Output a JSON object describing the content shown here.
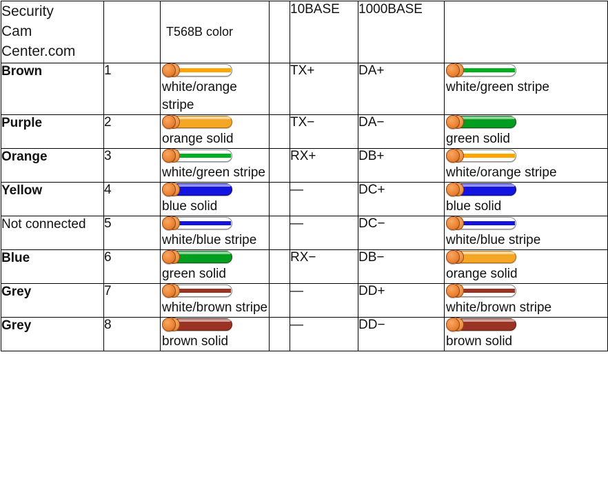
{
  "colors": {
    "orange": "#FFA500",
    "orange_solid_fill": "#F5A623",
    "orange_solid_border": "#A86A10",
    "green": "#00B020",
    "green_solid_fill": "#009E1F",
    "green_solid_border": "#0A5C12",
    "blue": "#1414E0",
    "blue_solid_fill": "#1414E0",
    "blue_solid_border": "#0A0A7A",
    "brown": "#9A3324",
    "brown_solid_fill": "#9A3324",
    "brown_solid_border": "#5E1E12",
    "cap": "#EF8A3C",
    "border": "#000000",
    "text": "#111111"
  },
  "header": {
    "brand": "Security Cam Center.com",
    "brand_lines": [
      "Security",
      "Cam",
      "Center.com"
    ],
    "pin_col": "",
    "t568b": "T568B color",
    "gap_col": "",
    "base10": "10BASE",
    "base1000": "1000BASE",
    "crossover": ""
  },
  "rows": [
    {
      "label": "Brown",
      "label_bold": true,
      "pin": "1",
      "t568b": {
        "text": "white/orange stripe",
        "style": "stripe",
        "color": "orange",
        "icon": "wire-white-orange-stripe-icon"
      },
      "base10": "TX+",
      "base1000": "DA+",
      "crossover": {
        "text": "white/green stripe",
        "style": "stripe",
        "color": "green",
        "icon": "wire-white-green-stripe-icon"
      }
    },
    {
      "label": "Purple",
      "label_bold": true,
      "pin": "2",
      "t568b": {
        "text": "orange solid",
        "style": "solid",
        "color": "orange",
        "icon": "wire-orange-solid-icon"
      },
      "base10": "TX−",
      "base1000": "DA−",
      "crossover": {
        "text": "green solid",
        "style": "solid",
        "color": "green",
        "icon": "wire-green-solid-icon"
      }
    },
    {
      "label": "Orange",
      "label_bold": true,
      "pin": "3",
      "t568b": {
        "text": "white/green stripe",
        "style": "stripe",
        "color": "green",
        "icon": "wire-white-green-stripe-icon"
      },
      "base10": "RX+",
      "base1000": "DB+",
      "crossover": {
        "text": "white/orange stripe",
        "style": "stripe",
        "color": "orange",
        "icon": "wire-white-orange-stripe-icon"
      }
    },
    {
      "label": "Yellow",
      "label_bold": true,
      "pin": "4",
      "t568b": {
        "text": "blue solid",
        "style": "solid",
        "color": "blue",
        "icon": "wire-blue-solid-icon"
      },
      "base10": "—",
      "base1000": "DC+",
      "crossover": {
        "text": "blue solid",
        "style": "solid",
        "color": "blue",
        "icon": "wire-blue-solid-icon"
      }
    },
    {
      "label": "Not connected",
      "label_bold": false,
      "pin": "5",
      "t568b": {
        "text": "white/blue stripe",
        "style": "stripe",
        "color": "blue",
        "icon": "wire-white-blue-stripe-icon"
      },
      "base10": "—",
      "base1000": "DC−",
      "crossover": {
        "text": "white/blue stripe",
        "style": "stripe",
        "color": "blue",
        "icon": "wire-white-blue-stripe-icon"
      }
    },
    {
      "label": "Blue",
      "label_bold": true,
      "pin": "6",
      "t568b": {
        "text": "green solid",
        "style": "solid",
        "color": "green",
        "icon": "wire-green-solid-icon"
      },
      "base10": "RX−",
      "base1000": "DB−",
      "crossover": {
        "text": "orange solid",
        "style": "solid",
        "color": "orange",
        "icon": "wire-orange-solid-icon"
      }
    },
    {
      "label": "Grey",
      "label_bold": true,
      "pin": "7",
      "t568b": {
        "text": "white/brown stripe",
        "style": "stripe",
        "color": "brown",
        "icon": "wire-white-brown-stripe-icon"
      },
      "base10": "—",
      "base1000": "DD+",
      "crossover": {
        "text": "white/brown stripe",
        "style": "stripe",
        "color": "brown",
        "icon": "wire-white-brown-stripe-icon"
      }
    },
    {
      "label": "Grey",
      "label_bold": true,
      "pin": "8",
      "t568b": {
        "text": "brown solid",
        "style": "solid",
        "color": "brown",
        "icon": "wire-brown-solid-icon"
      },
      "base10": "—",
      "base1000": "DD−",
      "crossover": {
        "text": "brown solid",
        "style": "solid",
        "color": "brown",
        "icon": "wire-brown-solid-icon"
      }
    }
  ]
}
